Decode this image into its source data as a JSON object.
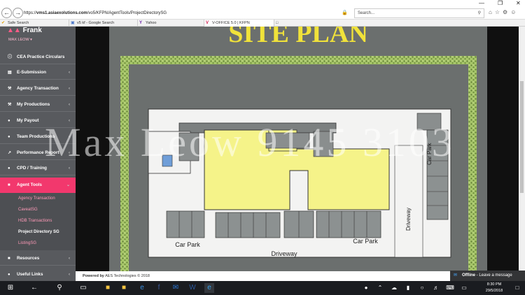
{
  "browser": {
    "url_prefix": "https://",
    "url_domain": "vms1.asiaexolutions.com",
    "url_path": "/vo5/KFPN/AgentTools/ProjectDirectorySG",
    "search_placeholder": "Search...",
    "tabs": [
      "Safe Search",
      "v5 kf - Google Search",
      "Yahoo",
      "V-OFFICE 5.0 | KFPN"
    ]
  },
  "sidebar": {
    "brand": "Frank",
    "user": "MAX LEOW",
    "items": [
      {
        "label": "CEA Practice Circulars",
        "icon": "info-icon"
      },
      {
        "label": "E-Submission",
        "icon": "document-icon"
      },
      {
        "label": "Agency Transaction",
        "icon": "gavel-icon"
      },
      {
        "label": "My Productions",
        "icon": "gavel-icon"
      },
      {
        "label": "My Payout",
        "icon": "user-icon"
      },
      {
        "label": "Team Productions",
        "icon": "team-icon"
      },
      {
        "label": "Performance Report",
        "icon": "chart-icon"
      },
      {
        "label": "CPD / Training",
        "icon": "car-icon"
      },
      {
        "label": "Agent Tools",
        "icon": "briefcase-icon"
      },
      {
        "label": "Resources",
        "icon": "folder-icon"
      },
      {
        "label": "Useful Links",
        "icon": "link-icon"
      }
    ],
    "sub_items": [
      "Agency Transaction",
      "CaveatSG",
      "HDB Transactions",
      "Project Directory SG",
      "ListingSG"
    ]
  },
  "plan": {
    "title": "SITE PLAN",
    "labels": {
      "car_park_left": "Car Park",
      "car_park_right": "Car Park",
      "car_park_top": "Car Park",
      "driveway_bottom": "Driveway",
      "driveway_right": "Driveway"
    }
  },
  "watermark": "Max Leow 9145 3103",
  "footer": {
    "prefix": "Powered by",
    "rest": "AES Technologies © 2018"
  },
  "chat": {
    "status": "Offline",
    "message": "Leave a message"
  },
  "taskbar": {
    "time": "8:30 PM",
    "date": "29/5/2018"
  }
}
